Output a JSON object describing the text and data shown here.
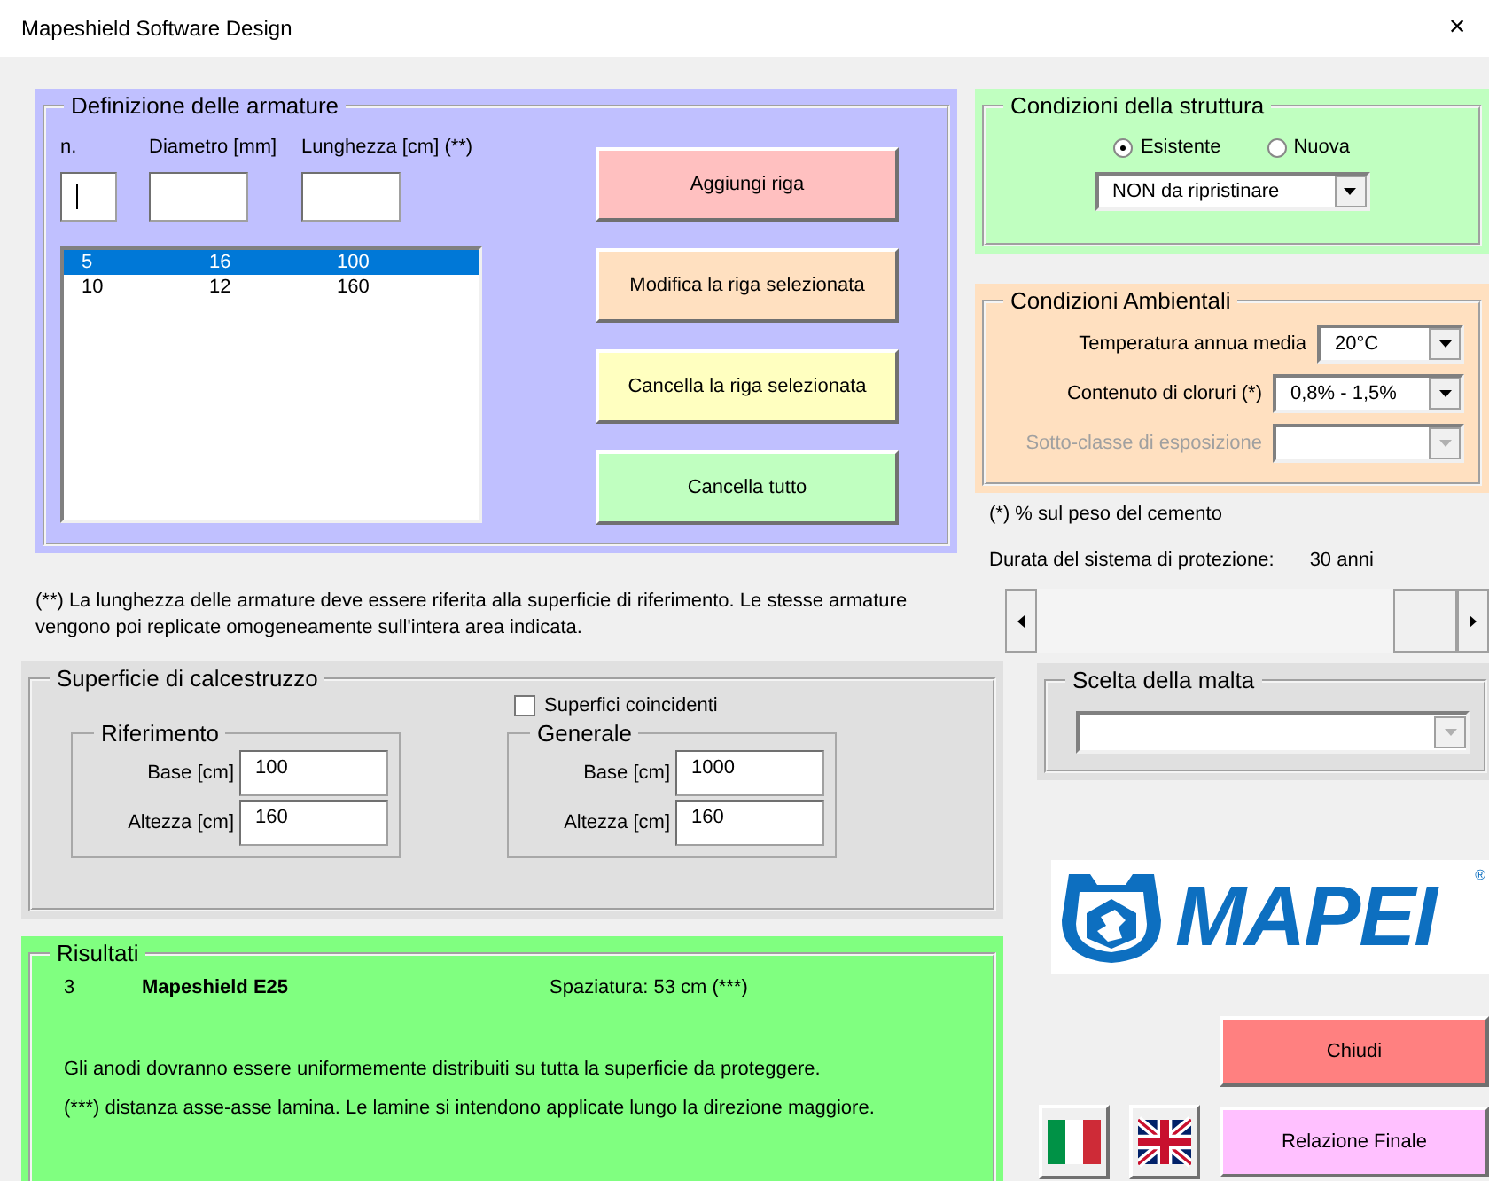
{
  "window": {
    "title": "Mapeshield Software Design",
    "close": "×"
  },
  "armature": {
    "title": "Definizione delle armature",
    "inputs": [
      {
        "label": "n.",
        "focused": true
      },
      {
        "label": "Diametro [mm]",
        "focused": false
      },
      {
        "label": "Lunghezza [cm] (**)",
        "focused": false
      }
    ],
    "rows": [
      {
        "n": "5",
        "diametro": "16",
        "lunghezza": "100",
        "selected": true
      },
      {
        "n": "10",
        "diametro": "12",
        "lunghezza": "160",
        "selected": false
      }
    ],
    "buttons": [
      {
        "label": "Aggiungi riga",
        "color": "#ffc0c0"
      },
      {
        "label": "Modifica la riga selezionata",
        "color": "#ffe0c0"
      },
      {
        "label": "Cancella la riga selezionata",
        "color": "#ffffc0"
      },
      {
        "label": "Cancella tutto",
        "color": "#c0ffc0"
      }
    ]
  },
  "note": "(**) La lunghezza delle armature deve essere riferita alla superficie di riferimento. Le stesse armature vengono poi replicate omogeneamente sull'intera area indicata.",
  "struttura": {
    "title": "Condizioni della struttura",
    "options": [
      {
        "label": "Esistente",
        "selected": true
      },
      {
        "label": "Nuova",
        "selected": false
      }
    ],
    "dropdown": {
      "value": "NON da ripristinare"
    }
  },
  "ambientali": {
    "title": "Condizioni Ambientali",
    "fields": [
      {
        "label": "Temperatura annua media",
        "value": "20°C",
        "disabled": false
      },
      {
        "label": "Contenuto di cloruri (*)",
        "value": "0,8% - 1,5%",
        "disabled": false
      },
      {
        "label": "Sotto-classe di esposizione",
        "disabled": true
      }
    ]
  },
  "footnote": "(*) % sul peso del cemento",
  "durata": {
    "label": "Durata del sistema di protezione:",
    "value": "30 anni"
  },
  "superficie": {
    "title": "Superficie di calcestruzzo",
    "checkbox": {
      "label": "Superfici coincidenti",
      "checked": false
    },
    "groups": [
      {
        "title": "Riferimento",
        "fields": [
          {
            "label": "Base [cm]",
            "value": "100"
          },
          {
            "label": "Altezza [cm]",
            "value": "160"
          }
        ]
      },
      {
        "title": "Generale",
        "fields": [
          {
            "label": "Base [cm]",
            "value": "1000"
          },
          {
            "label": "Altezza [cm]",
            "value": "160"
          }
        ]
      }
    ]
  },
  "malta": {
    "title": "Scelta della malta",
    "dropdown": {
      "disabled": true
    }
  },
  "logo": {
    "text": "MAPEI",
    "mark": "®"
  },
  "risultati": {
    "title": "Risultati",
    "count": "3",
    "product": "Mapeshield E25",
    "spacing": "Spaziatura: 53 cm (***)",
    "lines": [
      "Gli anodi dovranno essere uniformemente distribuiti su tutta la superficie da proteggere.",
      "(***) distanza asse-asse lamina. Le lamine si intendono applicate lungo la direzione maggiore."
    ]
  },
  "actions": {
    "close": "Chiudi",
    "report": "Relazione Finale"
  }
}
